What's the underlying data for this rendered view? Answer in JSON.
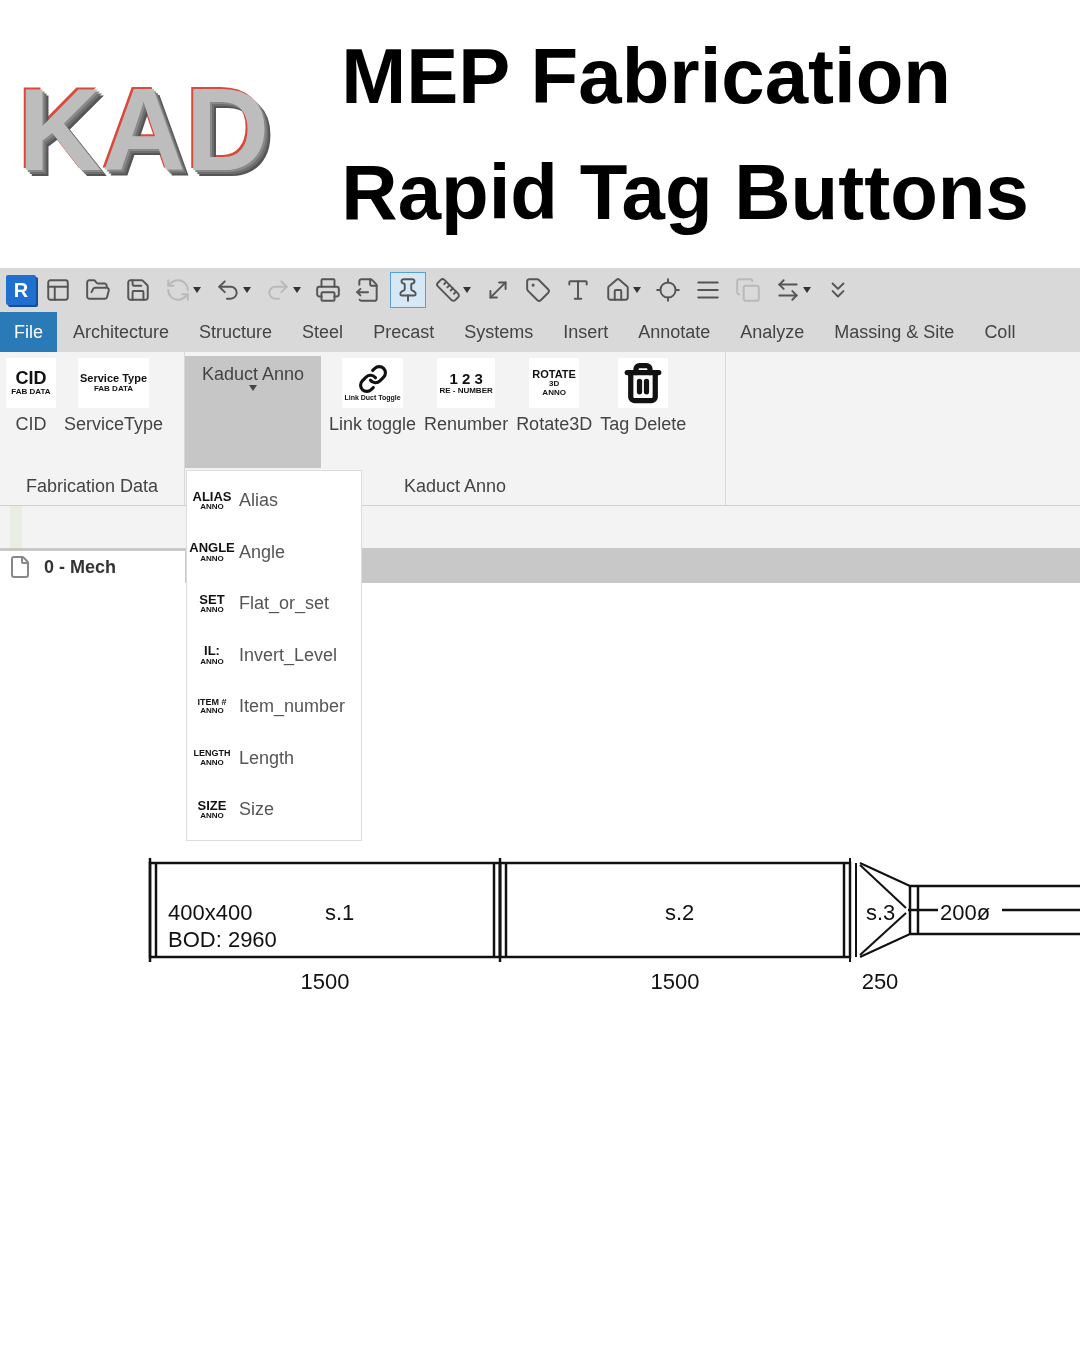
{
  "header": {
    "logo": "KAD",
    "title_lines": [
      "MEP Fabrication",
      "Rapid Tag Buttons"
    ]
  },
  "quick_access": {
    "app_logo": "R",
    "tools": [
      {
        "kind": "properties",
        "disabled": false,
        "selected": false,
        "dropdown": false
      },
      {
        "kind": "open",
        "disabled": false,
        "selected": false,
        "dropdown": false
      },
      {
        "kind": "save",
        "disabled": false,
        "selected": false,
        "dropdown": false
      },
      {
        "kind": "sync",
        "disabled": true,
        "selected": false,
        "dropdown": true
      },
      {
        "kind": "undo",
        "disabled": false,
        "selected": false,
        "dropdown": true
      },
      {
        "kind": "redo",
        "disabled": true,
        "selected": false,
        "dropdown": true
      },
      {
        "kind": "print",
        "disabled": false,
        "selected": false,
        "dropdown": false
      },
      {
        "kind": "export",
        "disabled": false,
        "selected": false,
        "dropdown": false
      },
      {
        "kind": "pin",
        "disabled": false,
        "selected": true,
        "dropdown": false
      },
      {
        "kind": "measure",
        "disabled": false,
        "selected": false,
        "dropdown": true
      },
      {
        "kind": "dimension",
        "disabled": false,
        "selected": false,
        "dropdown": false
      },
      {
        "kind": "tag",
        "disabled": false,
        "selected": false,
        "dropdown": false
      },
      {
        "kind": "text",
        "disabled": false,
        "selected": false,
        "dropdown": false
      },
      {
        "kind": "home",
        "disabled": false,
        "selected": false,
        "dropdown": true
      },
      {
        "kind": "section",
        "disabled": false,
        "selected": false,
        "dropdown": false
      },
      {
        "kind": "thin-lines",
        "disabled": false,
        "selected": false,
        "dropdown": false
      },
      {
        "kind": "close-windows",
        "disabled": true,
        "selected": false,
        "dropdown": false
      },
      {
        "kind": "switch-windows",
        "disabled": false,
        "selected": false,
        "dropdown": true
      },
      {
        "kind": "customize",
        "disabled": false,
        "selected": false,
        "dropdown": false
      }
    ]
  },
  "tabs": [
    {
      "label": "File",
      "selected": true
    },
    {
      "label": "Architecture",
      "selected": false
    },
    {
      "label": "Structure",
      "selected": false
    },
    {
      "label": "Steel",
      "selected": false
    },
    {
      "label": "Precast",
      "selected": false
    },
    {
      "label": "Systems",
      "selected": false
    },
    {
      "label": "Insert",
      "selected": false
    },
    {
      "label": "Annotate",
      "selected": false
    },
    {
      "label": "Analyze",
      "selected": false
    },
    {
      "label": "Massing & Site",
      "selected": false
    },
    {
      "label": "Coll",
      "selected": false
    }
  ],
  "ribbon": {
    "panels": [
      {
        "title": "Fabrication Data",
        "items": [
          {
            "kind": "button",
            "label": "CID",
            "icon_text": [
              "CID",
              "FAB DATA"
            ]
          },
          {
            "kind": "button",
            "label": "ServiceType",
            "icon_text": [
              "Service Type",
              "FAB DATA"
            ]
          }
        ]
      },
      {
        "title": "Kaduct Anno",
        "items": [
          {
            "kind": "split",
            "label": "Kaduct Anno",
            "expanded": true
          },
          {
            "kind": "link-button",
            "label": "Link toggle",
            "icon_text": [
              "Link Duct Toggle"
            ]
          },
          {
            "kind": "button",
            "label": "Renumber",
            "icon_text": [
              "1 2 3",
              "RE - NUMBER"
            ]
          },
          {
            "kind": "button",
            "label": "Rotate3D",
            "icon_text": [
              "ROTATE",
              "3D",
              "ANNO"
            ]
          },
          {
            "kind": "trash-button",
            "label": "Tag Delete"
          }
        ]
      }
    ]
  },
  "dropdown_menu": [
    {
      "label": "Alias",
      "icon_text": [
        "ALIAS",
        "ANNO"
      ]
    },
    {
      "label": "Angle",
      "icon_text": [
        "ANGLE",
        "ANNO"
      ]
    },
    {
      "label": "Flat_or_set",
      "icon_text": [
        "SET",
        "ANNO"
      ]
    },
    {
      "label": "Invert_Level",
      "icon_text": [
        "IL:",
        "ANNO"
      ]
    },
    {
      "label": "Item_number",
      "icon_text": [
        "ITEM #",
        "ANNO"
      ]
    },
    {
      "label": "Length",
      "icon_text": [
        "LENGTH",
        "ANNO"
      ]
    },
    {
      "label": "Size",
      "icon_text": [
        "SIZE",
        "ANNO"
      ]
    }
  ],
  "view_tab": {
    "label": "0 - Mech"
  },
  "duct_run": [
    {
      "kind": "rectangular",
      "label": "s.1",
      "notes": [
        "400x400",
        "BOD: 2960"
      ],
      "dimension": "1500"
    },
    {
      "kind": "rectangular",
      "label": "s.2",
      "dimension": "1500"
    },
    {
      "kind": "transition",
      "label": "s.3",
      "dimension": "250"
    },
    {
      "kind": "round",
      "label": "200ø"
    }
  ]
}
